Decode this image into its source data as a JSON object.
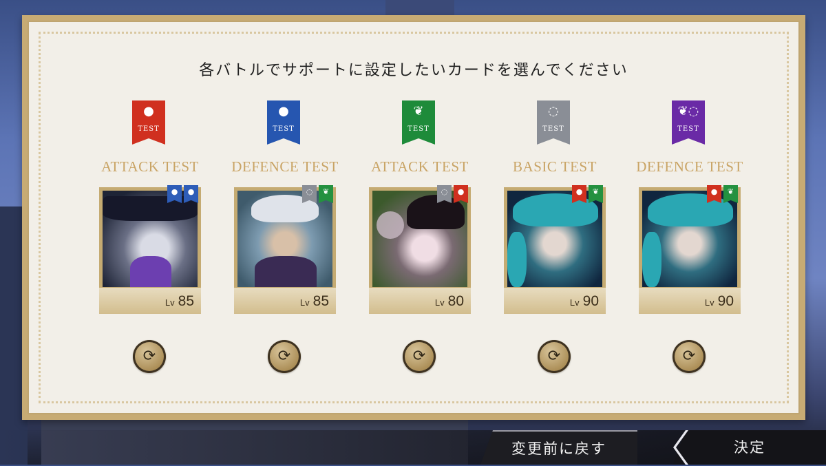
{
  "title": "各バトルでサポートに設定したいカードを選んでください",
  "slots": [
    {
      "banner_color": "#d0301f",
      "banner_icon": "flame",
      "banner_glyph": "●",
      "banner_text": "TEST",
      "test_name": "ATTACK TEST",
      "level_prefix": "Lv",
      "level": "85",
      "card_attributes": [
        {
          "color": "#2e5db8",
          "icon": "water",
          "glyph": "●"
        },
        {
          "color": "#2e5db8",
          "icon": "water",
          "glyph": "●"
        }
      ],
      "portrait_colors": [
        "#1e2436",
        "#6a6f85",
        "#d9dbe5"
      ]
    },
    {
      "banner_color": "#2656b0",
      "banner_icon": "water",
      "banner_glyph": "●",
      "banner_text": "TEST",
      "test_name": "DEFENCE TEST",
      "level_prefix": "Lv",
      "level": "85",
      "card_attributes": [
        {
          "color": "#8a8e96",
          "icon": "cosmic",
          "glyph": "◌"
        },
        {
          "color": "#249140",
          "icon": "leaf",
          "glyph": "❦"
        }
      ],
      "portrait_colors": [
        "#7d9bb0",
        "#c7ced6",
        "#3a2b54"
      ]
    },
    {
      "banner_color": "#1e8b3a",
      "banner_icon": "leaf",
      "banner_glyph": "❦",
      "banner_text": "TEST",
      "test_name": "ATTACK TEST",
      "level_prefix": "Lv",
      "level": "80",
      "card_attributes": [
        {
          "color": "#8a8e96",
          "icon": "cosmic",
          "glyph": "◌"
        },
        {
          "color": "#d0301f",
          "icon": "flame",
          "glyph": "●"
        }
      ],
      "portrait_colors": [
        "#3c5a2c",
        "#1a1218",
        "#e4d8e0"
      ]
    },
    {
      "banner_color": "#8a8e96",
      "banner_icon": "cosmic",
      "banner_glyph": "◌",
      "banner_text": "TEST",
      "test_name": "BASIC TEST",
      "level_prefix": "Lv",
      "level": "90",
      "card_attributes": [
        {
          "color": "#d0301f",
          "icon": "flame",
          "glyph": "●"
        },
        {
          "color": "#249140",
          "icon": "leaf",
          "glyph": "❦"
        }
      ],
      "portrait_colors": [
        "#10263f",
        "#2aa7b3",
        "#e3d7d0"
      ]
    },
    {
      "banner_color": "#6a2aa6",
      "banner_icon": "multi",
      "banner_glyph": "❦◌",
      "banner_text": "TEST",
      "test_name": "DEFENCE TEST",
      "level_prefix": "Lv",
      "level": "90",
      "card_attributes": [
        {
          "color": "#d0301f",
          "icon": "flame",
          "glyph": "●"
        },
        {
          "color": "#249140",
          "icon": "leaf",
          "glyph": "❦"
        }
      ],
      "portrait_colors": [
        "#10263f",
        "#2aa7b3",
        "#e3d7d0"
      ]
    }
  ],
  "swap_icon": "swap-arrows-icon",
  "swap_glyph": "⟳",
  "buttons": {
    "revert": "変更前に戻す",
    "confirm": "決定"
  },
  "colors": {
    "panel_gold": "#c7ab74",
    "test_label": "#c9a465"
  }
}
